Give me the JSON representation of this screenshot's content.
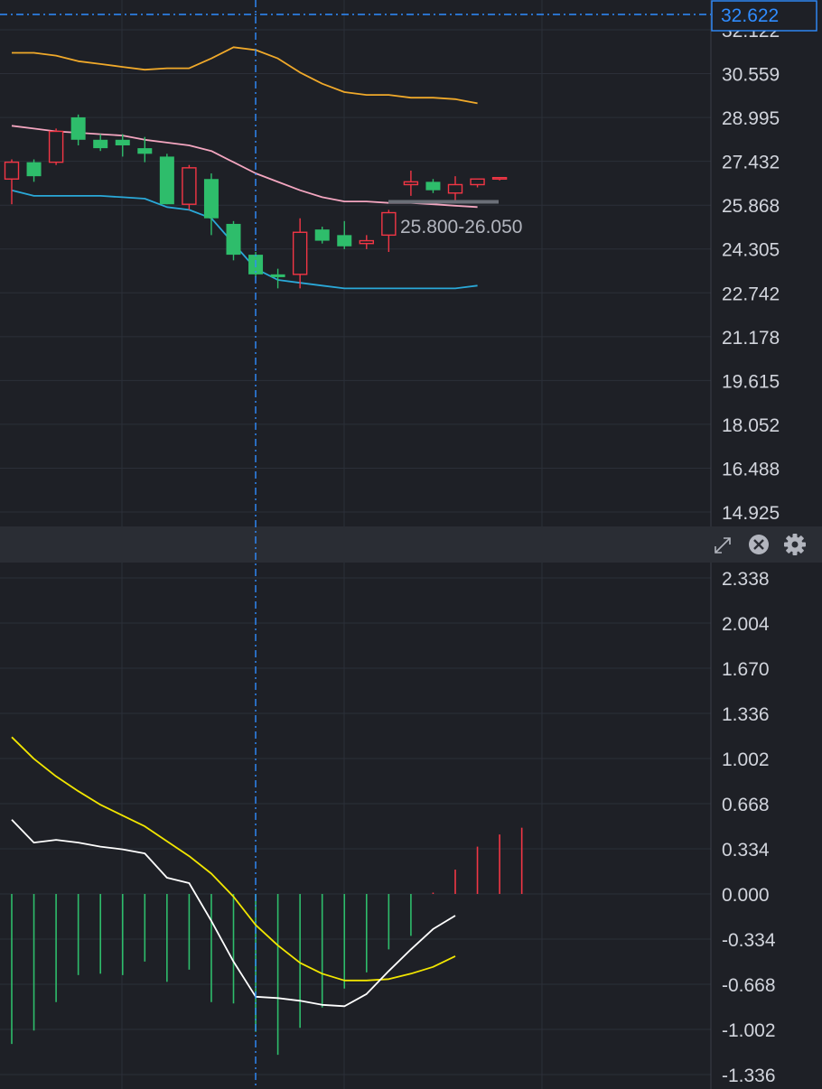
{
  "theme": {
    "background": "#1e2026",
    "grid": "#2b2f38",
    "separator": "#2a2d34",
    "up": "#f23645",
    "down": "#2ebd6b",
    "boll_upper": "#f0a92a",
    "boll_mid": "#f4a6c0",
    "boll_lower": "#2aa8d8",
    "dif": "#ffffff",
    "dea": "#f2e600",
    "crosshair": "#2f8cff"
  },
  "crosshair": {
    "price_label": "32.622",
    "price": 32.622
  },
  "range_label": {
    "text": "25.800-26.050",
    "low": 25.8,
    "high": 26.05
  },
  "pane_controls": {
    "expand": "expand-icon",
    "close": "close-icon",
    "settings": "gear-icon"
  },
  "chart_data": [
    {
      "type": "candlestick",
      "yticks": [
        "32.122",
        "30.559",
        "28.995",
        "27.432",
        "25.868",
        "24.305",
        "22.742",
        "21.178",
        "19.615",
        "18.052",
        "16.488",
        "14.925"
      ],
      "ylim": [
        14.925,
        32.7
      ],
      "candles": [
        {
          "o": 26.8,
          "h": 27.5,
          "l": 25.9,
          "c": 27.4
        },
        {
          "o": 27.4,
          "h": 27.5,
          "l": 26.7,
          "c": 26.9
        },
        {
          "o": 27.4,
          "h": 28.6,
          "l": 27.3,
          "c": 28.5
        },
        {
          "o": 29.0,
          "h": 29.1,
          "l": 28.0,
          "c": 28.2
        },
        {
          "o": 28.2,
          "h": 28.4,
          "l": 27.8,
          "c": 27.9
        },
        {
          "o": 28.2,
          "h": 28.4,
          "l": 27.6,
          "c": 28.0
        },
        {
          "o": 27.9,
          "h": 28.3,
          "l": 27.4,
          "c": 27.7
        },
        {
          "o": 27.6,
          "h": 27.7,
          "l": 25.9,
          "c": 25.9
        },
        {
          "o": 25.9,
          "h": 27.3,
          "l": 25.7,
          "c": 27.2
        },
        {
          "o": 26.8,
          "h": 27.0,
          "l": 24.8,
          "c": 25.4
        },
        {
          "o": 25.2,
          "h": 25.3,
          "l": 23.9,
          "c": 24.1
        },
        {
          "o": 24.1,
          "h": 24.2,
          "l": 23.3,
          "c": 23.4
        },
        {
          "o": 23.4,
          "h": 23.6,
          "l": 22.9,
          "c": 23.3
        },
        {
          "o": 23.4,
          "h": 25.4,
          "l": 22.9,
          "c": 24.9
        },
        {
          "o": 25.0,
          "h": 25.1,
          "l": 24.5,
          "c": 24.6
        },
        {
          "o": 24.8,
          "h": 25.3,
          "l": 24.3,
          "c": 24.4
        },
        {
          "o": 24.5,
          "h": 24.8,
          "l": 24.3,
          "c": 24.6
        },
        {
          "o": 24.8,
          "h": 25.7,
          "l": 24.2,
          "c": 25.6
        },
        {
          "o": 26.6,
          "h": 27.1,
          "l": 26.2,
          "c": 26.7
        },
        {
          "o": 26.7,
          "h": 26.8,
          "l": 26.3,
          "c": 26.4
        },
        {
          "o": 26.3,
          "h": 26.9,
          "l": 26.0,
          "c": 26.6
        },
        {
          "o": 26.6,
          "h": 26.8,
          "l": 26.5,
          "c": 26.8
        },
        {
          "o": 26.8,
          "h": 26.85,
          "l": 26.75,
          "c": 26.85
        }
      ],
      "boll_upper": [
        31.3,
        31.3,
        31.2,
        31.0,
        30.9,
        30.8,
        30.7,
        30.75,
        30.75,
        31.1,
        31.5,
        31.4,
        31.1,
        30.6,
        30.2,
        29.9,
        29.8,
        29.8,
        29.7,
        29.7,
        29.65,
        29.5
      ],
      "boll_mid": [
        28.7,
        28.6,
        28.5,
        28.45,
        28.4,
        28.35,
        28.2,
        28.1,
        28.0,
        27.8,
        27.4,
        27.0,
        26.7,
        26.4,
        26.15,
        26.0,
        26.0,
        25.95,
        25.95,
        25.9,
        25.85,
        25.8
      ],
      "boll_lower": [
        26.4,
        26.2,
        26.2,
        26.2,
        26.2,
        26.15,
        26.1,
        25.8,
        25.7,
        25.4,
        24.5,
        23.6,
        23.2,
        23.1,
        23.0,
        22.9,
        22.9,
        22.9,
        22.9,
        22.9,
        22.9,
        23.0
      ]
    },
    {
      "type": "macd",
      "yticks": [
        "2.338",
        "2.004",
        "1.670",
        "1.336",
        "1.002",
        "0.668",
        "0.334",
        "0.000",
        "-0.334",
        "-0.668",
        "-1.002",
        "-1.336"
      ],
      "ylim": [
        -1.336,
        2.338
      ],
      "dif": [
        0.55,
        0.38,
        0.4,
        0.38,
        0.35,
        0.33,
        0.3,
        0.12,
        0.08,
        -0.2,
        -0.5,
        -0.76,
        -0.77,
        -0.79,
        -0.82,
        -0.83,
        -0.74,
        -0.57,
        -0.41,
        -0.26,
        -0.16
      ],
      "dea": [
        1.16,
        1.0,
        0.87,
        0.76,
        0.66,
        0.58,
        0.5,
        0.39,
        0.28,
        0.15,
        -0.02,
        -0.23,
        -0.38,
        -0.51,
        -0.59,
        -0.64,
        -0.64,
        -0.63,
        -0.59,
        -0.54,
        -0.46
      ],
      "histogram": [
        -1.11,
        -1.01,
        -0.8,
        -0.6,
        -0.59,
        -0.6,
        -0.5,
        -0.65,
        -0.56,
        -0.8,
        -0.81,
        -1.02,
        -1.19,
        -0.99,
        -0.84,
        -0.7,
        -0.58,
        -0.41,
        -0.31,
        0.01,
        0.18,
        0.35,
        0.44,
        0.49
      ]
    }
  ]
}
